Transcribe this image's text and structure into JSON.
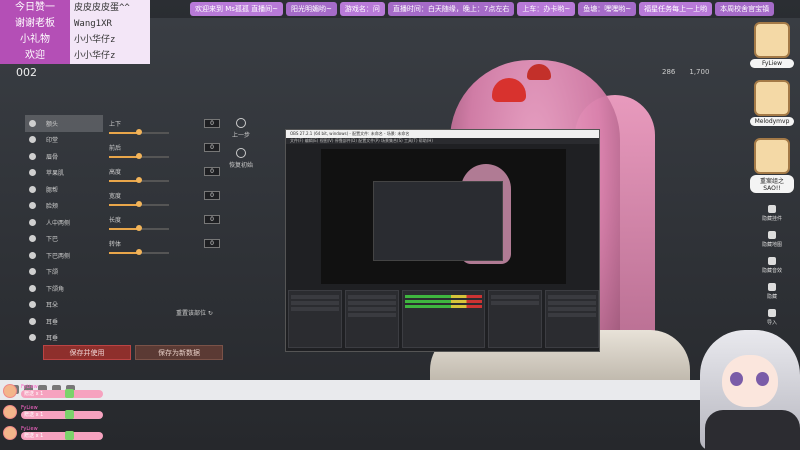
{
  "tickers": [
    "欢迎来到 Ms孤孤 直播间~",
    "阳光明媚哟~",
    "游戏名：问",
    "直播时间：白天随缘，晚上：7点左右",
    "上车：办卡哟~",
    "鱼塘：嘿嘿哟~",
    "福星任务每上一上哟",
    "本周校舍官宝镇"
  ],
  "info": [
    {
      "key": "今日赞一",
      "value": "皮皮皮皮蛋^^"
    },
    {
      "key": "谢谢老板",
      "value": "Wang1XR"
    },
    {
      "key": "小礼物",
      "value": "小小华仔z"
    },
    {
      "key": "欢迎",
      "value": "小小华仔z"
    }
  ],
  "slot_id": "002",
  "counters": {
    "currency1": "286",
    "currency2": "1,700"
  },
  "face_parts": [
    "额头",
    "印堂",
    "眉骨",
    "苹果肌",
    "腮帮",
    "脸颊",
    "人中两侧",
    "下巴",
    "下巴两侧",
    "下颌",
    "下颌角",
    "耳朵",
    "耳垂",
    "耳垂"
  ],
  "sliders": [
    {
      "label": "上下",
      "value": "0",
      "level": 0.5
    },
    {
      "label": "前后",
      "value": "0",
      "level": 0.5
    },
    {
      "label": "高度",
      "value": "0",
      "level": 0.5
    },
    {
      "label": "宽度",
      "value": "0",
      "level": 0.5
    },
    {
      "label": "长度",
      "value": "0",
      "level": 0.5
    },
    {
      "label": "转体",
      "value": "0",
      "level": 0.5
    }
  ],
  "tools": {
    "undo": "上一步",
    "reset_all": "恢复初始",
    "reset_part": "重置该部位"
  },
  "buttons": {
    "save_use": "保存并使用",
    "save_data": "保存为新数据"
  },
  "obs": {
    "title": "OBS 27.2.1 (64 bit, windows) - 配置文件: 未命名 - 场景: 未命名",
    "menu": "文件(F)  编辑(E)  视图(V)  停靠部件(D)  配置文件(P)  场景集合(S)  工具(T)  帮助(H)"
  },
  "chat": [
    {
      "name": "FyLiew",
      "text": "赠送 x 1"
    },
    {
      "name": "FyLiew",
      "text": "赠送 x 1"
    },
    {
      "name": "FyLiew",
      "text": "赠送 x 1"
    }
  ],
  "viewers": [
    {
      "name": "FyLiew"
    },
    {
      "name": "Melodymvp"
    },
    {
      "name": "重案组之SAO!!"
    }
  ],
  "right_tools": [
    "隐藏挂件",
    "隐藏地图",
    "隐藏音效",
    "隐藏",
    "导入"
  ],
  "colors": {
    "panel_key": "#b44fb6",
    "ticker": "#b87ad8",
    "slider_fill": "#e9a64a",
    "save_button": "#8e2f2c"
  }
}
